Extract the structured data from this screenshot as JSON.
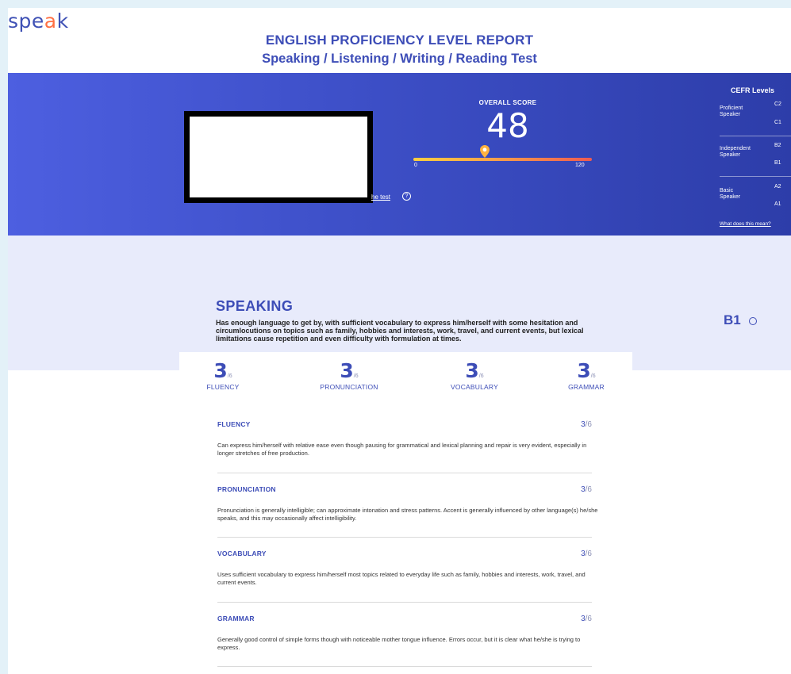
{
  "brand": {
    "logo_prefix": "spe",
    "logo_accent": "a",
    "logo_suffix": "k"
  },
  "header": {
    "title": "ENGLISH PROFICIENCY LEVEL REPORT",
    "subtitle": "Speaking / Listening / Writing / Reading Test"
  },
  "hero": {
    "test_link": "he test",
    "overall_label": "OVERALL SCORE",
    "overall_value": "48",
    "overall_numeric": 48,
    "bar_min": "0",
    "bar_max": "120",
    "bar_max_numeric": 120
  },
  "cefr": {
    "title": "CEFR Levels",
    "groups": [
      {
        "label_1": "Proficient",
        "label_2": "Speaker",
        "levels": [
          "C2",
          "C1"
        ]
      },
      {
        "label_1": "Independent",
        "label_2": "Speaker",
        "levels": [
          "B2",
          "B1"
        ]
      },
      {
        "label_1": "Basic",
        "label_2": "Speaker",
        "levels": [
          "A2",
          "A1"
        ]
      }
    ],
    "link": "What does this mean?"
  },
  "speaking": {
    "title": "SPEAKING",
    "description": "Has enough language to get by, with sufficient vocabulary to express him/herself with some hesitation and circumlocutions on topics such as family, hobbies and interests, work, travel, and current events, but lexical limitations cause repetition and even difficulty with formulation at times.",
    "level": "B1",
    "scores": [
      {
        "value": "3",
        "max": "/6",
        "name": "FLUENCY"
      },
      {
        "value": "3",
        "max": "/6",
        "name": "PRONUNCIATION"
      },
      {
        "value": "3",
        "max": "/6",
        "name": "VOCABULARY"
      },
      {
        "value": "3",
        "max": "/6",
        "name": "GRAMMAR"
      }
    ],
    "details": [
      {
        "title": "FLUENCY",
        "score": "3",
        "max": "/6",
        "description": "Can express him/herself with relative ease even though pausing for grammatical and lexical planning and repair is very evident, especially in longer stretches of free production."
      },
      {
        "title": "PRONUNCIATION",
        "score": "3",
        "max": "/6",
        "description": "Pronunciation is generally intelligible; can approximate intonation and stress patterns. Accent is generally influenced by other language(s) he/she speaks, and this may occasionally affect intelligibility."
      },
      {
        "title": "VOCABULARY",
        "score": "3",
        "max": "/6",
        "description": "Uses sufficient vocabulary to express him/herself most topics related to everyday life such as family, hobbies and interests, work, travel, and current events."
      },
      {
        "title": "GRAMMAR",
        "score": "3",
        "max": "/6",
        "description": "Generally good control of simple forms though with noticeable mother tongue influence. Errors occur, but it is clear what he/she is trying to express."
      }
    ]
  }
}
